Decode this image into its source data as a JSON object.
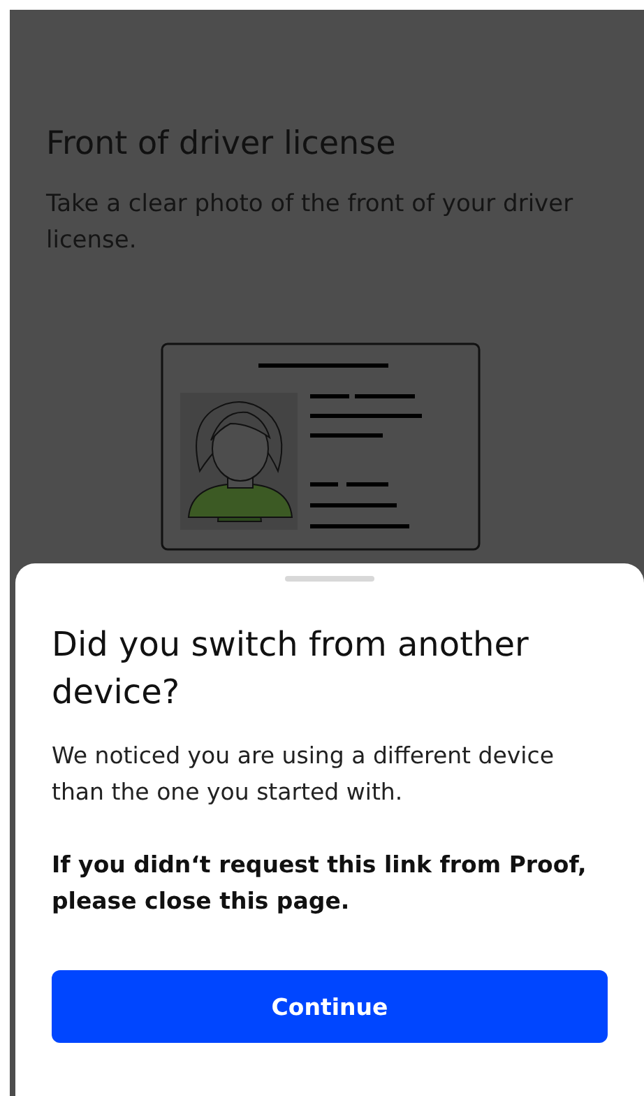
{
  "page": {
    "title": "Front of driver license",
    "description": "Take a clear photo of the front of your driver license."
  },
  "sheet": {
    "title": "Did you switch from another device?",
    "message": "We noticed you are using a different device than the one you started with.",
    "warning": "If you didn‘t request this link from Proof, please close this page.",
    "button": "Continue"
  }
}
